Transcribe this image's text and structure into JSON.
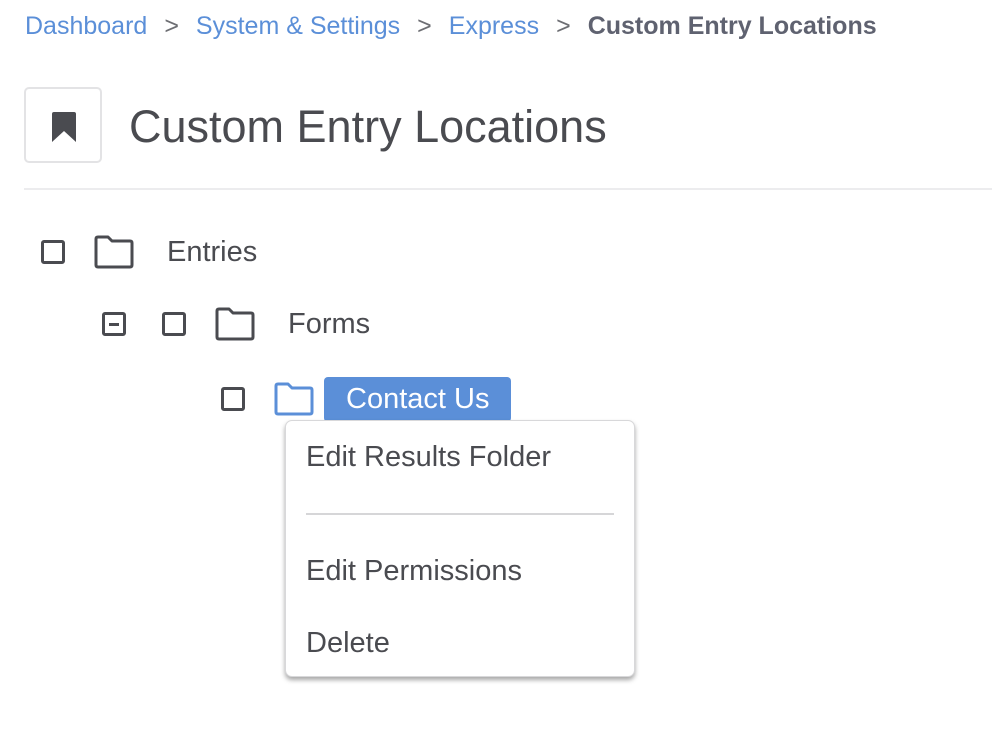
{
  "breadcrumb": {
    "items": [
      {
        "label": "Dashboard"
      },
      {
        "label": "System & Settings"
      },
      {
        "label": "Express"
      }
    ],
    "separator": ">",
    "current": "Custom Entry Locations"
  },
  "header": {
    "icon": "bookmark-icon",
    "title": "Custom Entry Locations"
  },
  "tree": {
    "nodes": [
      {
        "label": "Entries",
        "level": 0,
        "checked": false,
        "icon": "folder-icon"
      },
      {
        "label": "Forms",
        "level": 1,
        "checked": false,
        "expanded": true,
        "icon": "folder-icon"
      },
      {
        "label": "Contact Us",
        "level": 2,
        "checked": false,
        "selected": true,
        "icon": "folder-icon"
      }
    ]
  },
  "context_menu": {
    "items": [
      {
        "label": "Edit Results Folder"
      },
      {
        "label": "Edit Permissions"
      },
      {
        "label": "Delete"
      }
    ]
  },
  "colors": {
    "accent": "#5b8fd8",
    "text": "#4a4b50",
    "breadcrumb_current": "#5f6270"
  }
}
